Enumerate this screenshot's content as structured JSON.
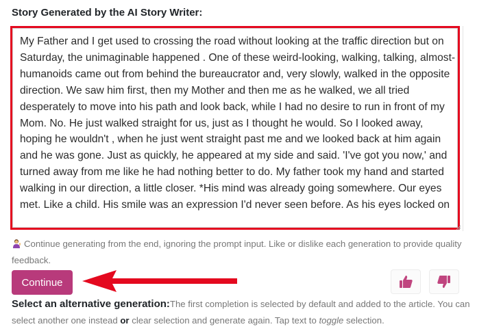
{
  "heading": "Story Generated by the AI Story Writer:",
  "story": {
    "text": "My Father and I get used to crossing the road without looking at the traffic direction but on Saturday, the unimaginable happened . One of these weird-looking, walking, talking, almost-humanoids came out from behind the bureaucrator and, very slowly, walked in the opposite direction. We saw him first, then my Mother and then me as he walked, we all tried desperately to move into his path and look back, while I had no desire to run in front of my Mom. No. He just walked straight for us, just as I thought he would. So I looked away, hoping he wouldn't , when he just went straight past me and we looked back at him again and he was gone. Just as quickly, he appeared at my side and said. 'I've got you now,' and turned away from me like he had nothing better to do. My father took my hand and started walking in our direction, a little closer. *His mind was already going somewhere. Our eyes met. Like a child. His smile was an expression I'd never seen before. As his eyes locked on"
  },
  "hint": "Continue generating from the end, ignoring the prompt input. Like or dislike each generation to provide quality feedback.",
  "continue_label": "Continue",
  "alt": {
    "title": "Select an alternative generation:",
    "part1": "The first completion is selected by default and added to the article. You can select another one instead ",
    "or": "or",
    "part2": " clear selection and generate again. Tap text to ",
    "toggle": "toggle",
    "part3": " selection."
  },
  "icons": {
    "hint": "person-tipping-hand-icon",
    "like": "thumbs-up-icon",
    "dislike": "thumbs-down-icon",
    "annotation": "red-arrow-annotation"
  },
  "colors": {
    "accent": "#b83a7b",
    "highlight": "#e4091f",
    "vote_icon": "#c0457f"
  }
}
